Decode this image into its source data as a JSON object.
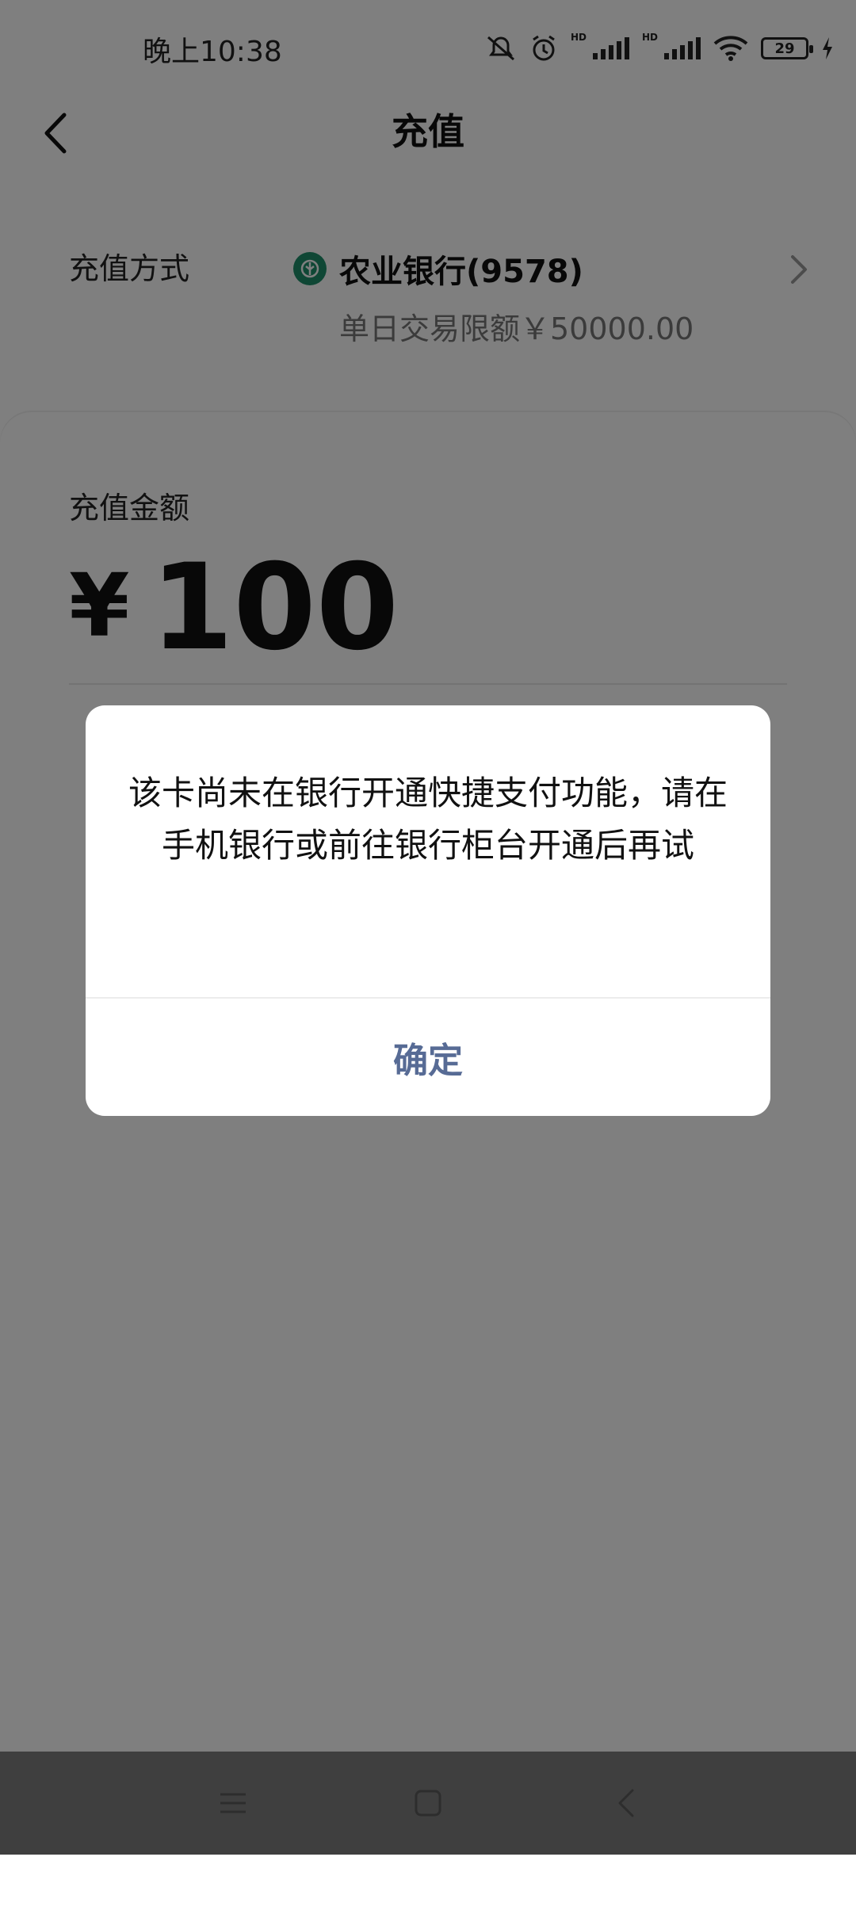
{
  "status_bar": {
    "time": "晚上10:38",
    "hd1": "HD",
    "hd2": "HD",
    "battery": "29"
  },
  "nav": {
    "title": "充值"
  },
  "payment": {
    "label": "充值方式",
    "bank_name": "农业银行(9578)",
    "limit": "单日交易限额￥50000.00"
  },
  "amount": {
    "label": "充值金额",
    "currency": "¥",
    "value": "100"
  },
  "dialog": {
    "message": "该卡尚未在银行开通快捷支付功能，请在手机银行或前往银行柜台开通后再试",
    "confirm": "确定"
  },
  "colors": {
    "link_blue": "#576b95",
    "bank_green": "#1f8e6a",
    "overlay": "rgba(0,0,0,0.5)"
  }
}
